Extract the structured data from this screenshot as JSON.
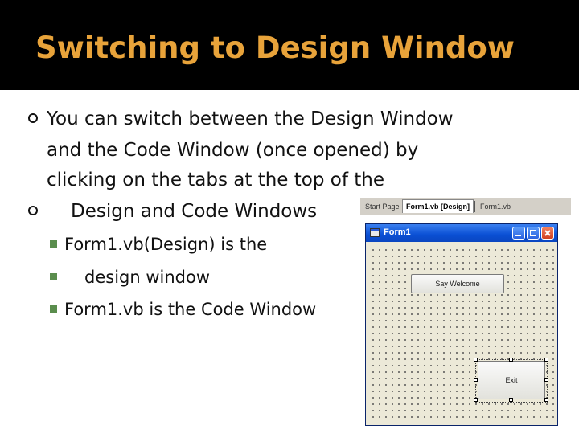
{
  "slide": {
    "title": "Switching to Design Window",
    "bullet1": {
      "line1": "You can switch between the Design Window",
      "line2": "and the Code Window (once opened) by",
      "line3": "clicking on the tabs at the top of the"
    },
    "bullet2": "Design and Code Windows",
    "sub1": "Form1.vb(Design) is the",
    "sub2": "design window",
    "sub3": "Form1.vb is the Code Window"
  },
  "ide": {
    "tabs": [
      "Start Page",
      "Form1.vb [Design]",
      "Form1.vb"
    ],
    "form_title": "Form1",
    "button_welcome": "Say Welcome",
    "button_exit": "Exit"
  },
  "colors": {
    "title": "#e8a33a",
    "header_bg": "#000000",
    "sub_bullet": "#5a8d4d"
  }
}
